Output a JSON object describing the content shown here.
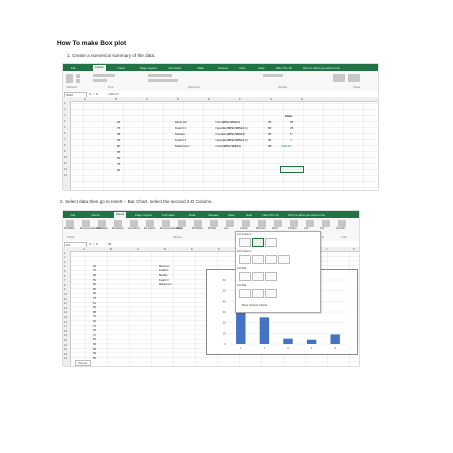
{
  "doc": {
    "title": "How To make Box plot",
    "step1": "1. Create a numerical summary of the data.",
    "step2": "2. Select data then go to Insert – Bar Chart, select the second 2-D Column."
  },
  "excel1": {
    "tabs": [
      "File",
      "Home",
      "Insert",
      "Page Layout",
      "Formulas",
      "Data",
      "Review",
      "View",
      "Help",
      "Nitro Pro 10",
      "Tell me what you want to do"
    ],
    "active_tab": "Home",
    "groups": [
      "Clipboard",
      "Font",
      "Alignment",
      "Number",
      "Styles"
    ],
    "namebox": "SUM",
    "formula": "=G8-G7",
    "columns": [
      "A",
      "B",
      "C",
      "D",
      "E",
      "F",
      "G",
      "H"
    ],
    "rows": [
      "1",
      "2",
      "3",
      "4",
      "5",
      "6",
      "7",
      "8",
      "9",
      "10",
      "11",
      "12",
      "13"
    ],
    "data_values": [
      "94",
      "76",
      "98",
      "55",
      "80",
      "85",
      "82",
      "78",
      "81"
    ],
    "stats_header": "Stats",
    "stat_labels": [
      "Minimum",
      "Kuartil 1",
      "Median",
      "Kuartil 3",
      "Maksimum"
    ],
    "formulas": [
      "=min($B$4:$B$24)",
      "=quartile($B$4:$B$24,1)",
      "=median($B$4:$B$24)",
      "=quartile($B$4:$B$24,3)",
      "=max($B$4:$B$24)"
    ],
    "g_values": [
      "55",
      "80",
      "85",
      "90",
      "98"
    ],
    "h_values": [
      "55",
      "25",
      "5",
      "4",
      ""
    ],
    "h_edit": "=G8-G7"
  },
  "excel2": {
    "tabs": [
      "File",
      "Home",
      "Insert",
      "Page Layout",
      "Formulas",
      "Data",
      "Review",
      "View",
      "Help",
      "Nitro Pro 10",
      "Tell me what you want to do"
    ],
    "active_tab": "Insert",
    "ribbon_buttons": [
      "PivotTable",
      "Recommended PivotTables",
      "Table",
      "Illustrations",
      "Get Add-ins",
      "My Add-ins",
      "Recommended Charts",
      "Maps",
      "PivotChart",
      "3D Map",
      "Line",
      "Column",
      "Win/Loss",
      "Slicer",
      "Timeline",
      "Link",
      "Text",
      "Symbols"
    ],
    "groups": [
      "Tables",
      "Add-ins",
      "Tours",
      "Sparklines",
      "Filters",
      "Links"
    ],
    "namebox": "H4",
    "formula": "55",
    "columns": [
      "A",
      "B",
      "C",
      "D",
      "E",
      "F",
      "G",
      "H",
      "I",
      "J",
      "K"
    ],
    "data_values": [
      "94",
      "76",
      "98",
      "55",
      "80",
      "85",
      "82",
      "78",
      "81",
      "90",
      "88",
      "75",
      "60",
      "70",
      "65",
      "72",
      "84",
      "68",
      "58",
      "99",
      "86"
    ],
    "stat_labels": [
      "Minimum",
      "Kuartil 1",
      "Median",
      "Kuartil 3",
      "Maksimum"
    ],
    "dd_sections": [
      "2-D Column",
      "3-D Column",
      "2-D Bar",
      "3-D Bar"
    ],
    "dd_more": "More Column Charts...",
    "sheet_tab": "Sheet1"
  },
  "chart_data": {
    "type": "bar",
    "categories": [
      "1",
      "2",
      "3",
      "4",
      "5"
    ],
    "values": [
      55,
      25,
      5,
      4,
      9
    ],
    "ylim": [
      0,
      60
    ],
    "ticks": [
      "60",
      "50",
      "40",
      "30",
      "20",
      "10",
      "0"
    ]
  }
}
